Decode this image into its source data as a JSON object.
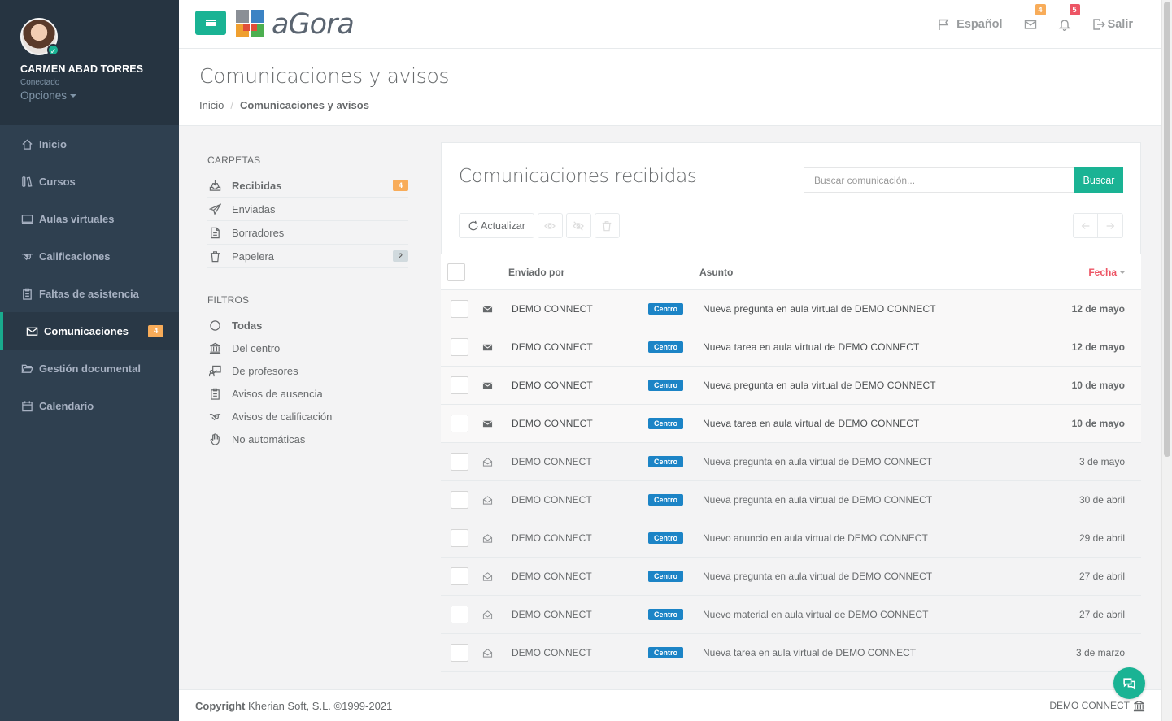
{
  "colors": {
    "sidebar_bg": "#2f4050",
    "sidebar_profile_bg": "#263441",
    "accent": "#1ab394",
    "badge_warning": "#f8ac59",
    "badge_danger": "#ed5565",
    "tag_blue": "#1c84c6"
  },
  "profile": {
    "name": "CARMEN ABAD TORRES",
    "status": "Conectado",
    "options_label": "Opciones"
  },
  "sidebar": {
    "items": [
      {
        "label": "Inicio",
        "icon": "home-icon"
      },
      {
        "label": "Cursos",
        "icon": "books-icon"
      },
      {
        "label": "Aulas virtuales",
        "icon": "monitor-icon"
      },
      {
        "label": "Calificaciones",
        "icon": "handshake-icon"
      },
      {
        "label": "Faltas de asistencia",
        "icon": "clipboard-icon"
      },
      {
        "label": "Comunicaciones",
        "icon": "envelope-icon",
        "badge": "4",
        "active": true
      },
      {
        "label": "Gestión documental",
        "icon": "folder-open-icon"
      },
      {
        "label": "Calendario",
        "icon": "calendar-icon"
      }
    ]
  },
  "topbar": {
    "logo_text": "aGora",
    "language": "Español",
    "mail_badge": "4",
    "bell_badge": "5",
    "logout": "Salir"
  },
  "page": {
    "title": "Comunicaciones y avisos",
    "breadcrumb_home": "Inicio",
    "breadcrumb_sep": "/",
    "breadcrumb_current": "Comunicaciones y avisos"
  },
  "folders": {
    "title": "CARPETAS",
    "items": [
      {
        "label": "Recibidas",
        "icon": "inbox-icon",
        "badge": "4"
      },
      {
        "label": "Enviadas",
        "icon": "paper-plane-icon"
      },
      {
        "label": "Borradores",
        "icon": "file-icon"
      },
      {
        "label": "Papelera",
        "icon": "trash-icon",
        "badge": "2"
      }
    ]
  },
  "filters": {
    "title": "FILTROS",
    "items": [
      {
        "label": "Todas",
        "icon": "circle-icon"
      },
      {
        "label": "Del centro",
        "icon": "institution-icon"
      },
      {
        "label": "De profesores",
        "icon": "teacher-icon"
      },
      {
        "label": "Avisos de ausencia",
        "icon": "clipboard-icon"
      },
      {
        "label": "Avisos de calificación",
        "icon": "handshake-icon"
      },
      {
        "label": "No automáticas",
        "icon": "hand-icon"
      }
    ]
  },
  "mail": {
    "title": "Comunicaciones recibidas",
    "search_placeholder": "Buscar comunicación...",
    "search_button": "Buscar",
    "refresh_label": "Actualizar",
    "columns": {
      "sender": "Enviado por",
      "subject": "Asunto",
      "date": "Fecha"
    },
    "rows": [
      {
        "sender": "DEMO CONNECT",
        "tag": "Centro",
        "subject": "Nueva pregunta en aula virtual de DEMO CONNECT",
        "date": "12 de mayo",
        "unread": true
      },
      {
        "sender": "DEMO CONNECT",
        "tag": "Centro",
        "subject": "Nueva tarea en aula virtual de DEMO CONNECT",
        "date": "12 de mayo",
        "unread": true
      },
      {
        "sender": "DEMO CONNECT",
        "tag": "Centro",
        "subject": "Nueva pregunta en aula virtual de DEMO CONNECT",
        "date": "10 de mayo",
        "unread": true
      },
      {
        "sender": "DEMO CONNECT",
        "tag": "Centro",
        "subject": "Nueva tarea en aula virtual de DEMO CONNECT",
        "date": "10 de mayo",
        "unread": true
      },
      {
        "sender": "DEMO CONNECT",
        "tag": "Centro",
        "subject": "Nueva pregunta en aula virtual de DEMO CONNECT",
        "date": "3 de mayo",
        "unread": false
      },
      {
        "sender": "DEMO CONNECT",
        "tag": "Centro",
        "subject": "Nueva pregunta en aula virtual de DEMO CONNECT",
        "date": "30 de abril",
        "unread": false
      },
      {
        "sender": "DEMO CONNECT",
        "tag": "Centro",
        "subject": "Nuevo anuncio en aula virtual de DEMO CONNECT",
        "date": "29 de abril",
        "unread": false
      },
      {
        "sender": "DEMO CONNECT",
        "tag": "Centro",
        "subject": "Nueva pregunta en aula virtual de DEMO CONNECT",
        "date": "27 de abril",
        "unread": false
      },
      {
        "sender": "DEMO CONNECT",
        "tag": "Centro",
        "subject": "Nuevo material en aula virtual de DEMO CONNECT",
        "date": "27 de abril",
        "unread": false
      },
      {
        "sender": "DEMO CONNECT",
        "tag": "Centro",
        "subject": "Nueva tarea en aula virtual de DEMO CONNECT",
        "date": "3 de marzo",
        "unread": false
      }
    ]
  },
  "footer": {
    "copyright_bold": "Copyright",
    "copyright_text": "Kherian Soft, S.L. ©1999-2021",
    "center_name": "DEMO CONNECT"
  }
}
